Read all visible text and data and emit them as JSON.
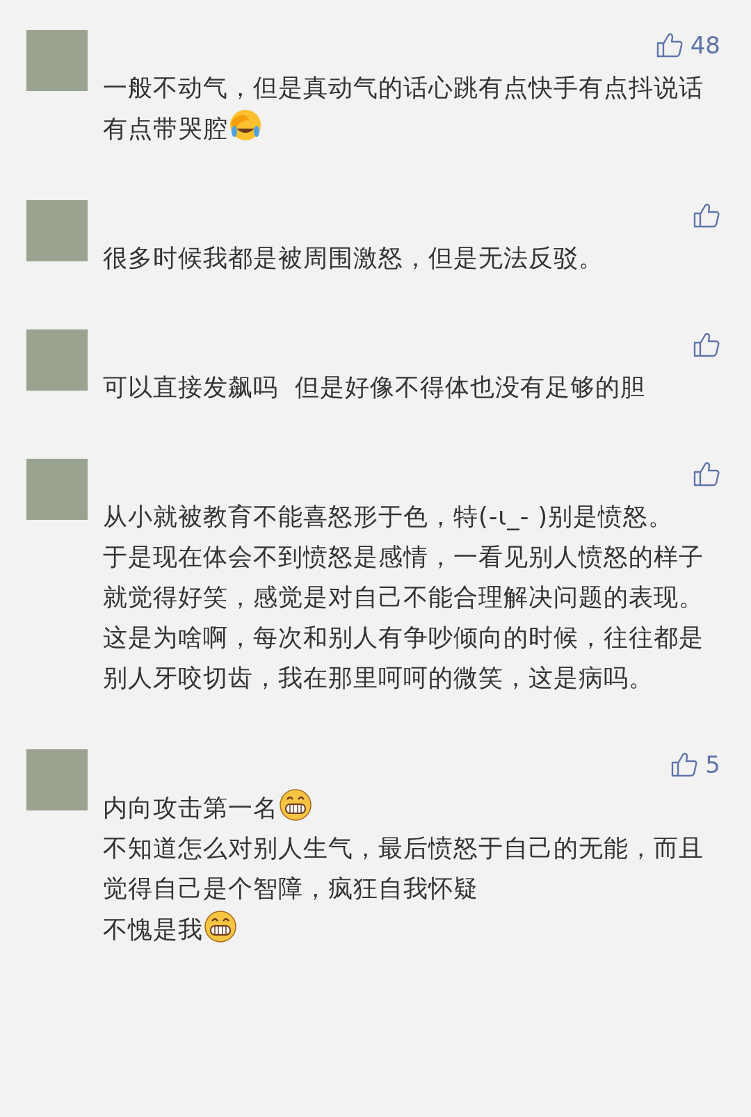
{
  "comments": [
    {
      "likes": "48",
      "paragraphs": [
        [
          {
            "kind": "text",
            "text": "一般不动气，但是真动气的话心跳有点快手有点抖说话有点带哭腔"
          },
          {
            "kind": "emoji-facepalm"
          }
        ]
      ]
    },
    {
      "paragraphs": [
        [
          {
            "kind": "text",
            "text": "很多时候我都是被周围激怒，但是无法反驳。"
          }
        ]
      ]
    },
    {
      "paragraphs": [
        [
          {
            "kind": "text",
            "text": "可以直接发飙吗  但是好像不得体也没有足够的胆"
          }
        ]
      ]
    },
    {
      "paragraphs": [
        [
          {
            "kind": "text",
            "text": "从小就被教育不能喜怒形于色，特(-ι_- )别是愤怒。"
          }
        ],
        [
          {
            "kind": "text",
            "text": "于是现在体会不到愤怒是感情，一看见别人愤怒的样子就觉得好笑，感觉是对自己不能合理解决问题的表现。"
          }
        ],
        [
          {
            "kind": "text",
            "text": "这是为啥啊，每次和别人有争吵倾向的时候，往往都是别人牙咬切齿，我在那里呵呵的微笑，这是病吗。"
          }
        ]
      ]
    },
    {
      "likes": "5",
      "paragraphs": [
        [
          {
            "kind": "text",
            "text": "内向攻击第一名"
          },
          {
            "kind": "emoji-grin"
          }
        ],
        [
          {
            "kind": "text",
            "text": "不知道怎么对别人生气，最后愤怒于自己的无能，而且觉得自己是个智障，疯狂自我怀疑"
          }
        ],
        [
          {
            "kind": "text",
            "text": "不愧是我"
          },
          {
            "kind": "emoji-grin"
          }
        ]
      ]
    }
  ]
}
